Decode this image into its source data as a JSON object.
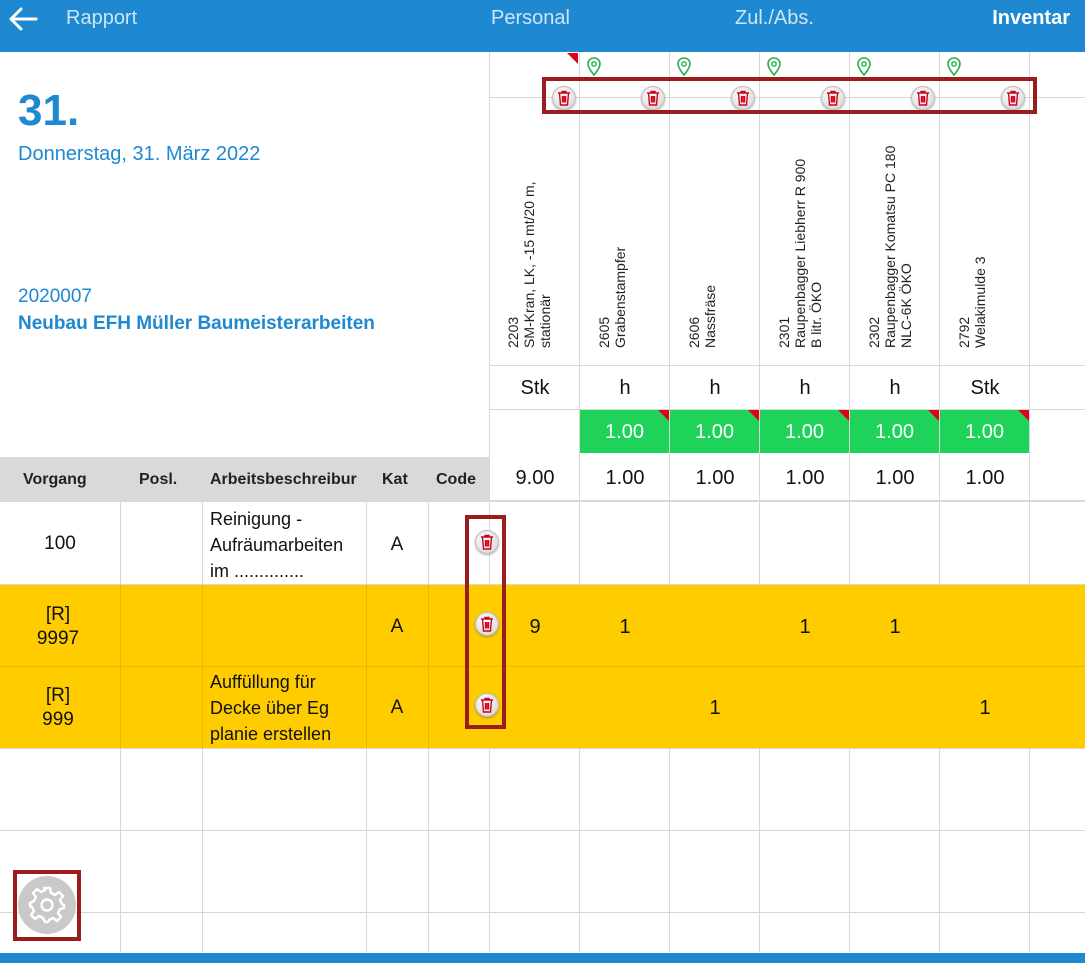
{
  "topbar": {
    "back_label": "Rapport",
    "tab_personal": "Personal",
    "tab_zul_abs": "Zul./Abs.",
    "tab_inventar": "Inventar",
    "color": "#1e88d0"
  },
  "header": {
    "day": "31.",
    "date_long": "Donnerstag, 31. März 2022",
    "project_number": "2020007",
    "project_name": "Neubau EFH Müller Baumeisterarbeiten"
  },
  "equipment": [
    {
      "number": "2203",
      "name_line1": "SM-Kran, LK, -15 mt/20 m,",
      "name_line2": "stationär",
      "unit": "Stk",
      "default_qty": "",
      "total": "9.00"
    },
    {
      "number": "2605",
      "name_line1": "Grabenstampfer",
      "name_line2": "",
      "unit": "h",
      "default_qty": "1.00",
      "total": "1.00"
    },
    {
      "number": "2606",
      "name_line1": "Nassfräse",
      "name_line2": "",
      "unit": "h",
      "default_qty": "1.00",
      "total": "1.00"
    },
    {
      "number": "2301",
      "name_line1": "Raupenbagger Liebherr R 900",
      "name_line2": "B litr. ÖKO",
      "unit": "h",
      "default_qty": "1.00",
      "total": "1.00"
    },
    {
      "number": "2302",
      "name_line1": "Raupenbagger Komatsu PC 180",
      "name_line2": "NLC-6K ÖKO",
      "unit": "h",
      "default_qty": "1.00",
      "total": "1.00"
    },
    {
      "number": "2792",
      "name_line1": "Welakimulde 3",
      "name_line2": "",
      "unit": "Stk",
      "default_qty": "1.00",
      "total": "1.00"
    }
  ],
  "columns": {
    "vorgang": "Vorgang",
    "posl": "Posl.",
    "arbeitsbeschreibung": "Arbeitsbeschreibur",
    "kat": "Kat",
    "code": "Code"
  },
  "rows": [
    {
      "vorgang_line1": "100",
      "vorgang_line2": "",
      "desc_line1": "Reinigung -",
      "desc_line2": "Aufräumarbeiten",
      "desc_line3": "im ..............",
      "kat": "A",
      "values": [
        "",
        "",
        "",
        "",
        "",
        ""
      ],
      "highlight": false
    },
    {
      "vorgang_line1": "[R]",
      "vorgang_line2": "9997",
      "desc_line1": "",
      "desc_line2": "",
      "desc_line3": "",
      "kat": "A",
      "values": [
        "9",
        "1",
        "",
        "1",
        "1",
        ""
      ],
      "highlight": true
    },
    {
      "vorgang_line1": "[R]",
      "vorgang_line2": "999",
      "desc_line1": "Auffüllung für",
      "desc_line2": "Decke über Eg",
      "desc_line3": "planie erstellen",
      "kat": "A",
      "values": [
        "",
        "",
        "1",
        "",
        "",
        "1"
      ],
      "highlight": true
    }
  ],
  "colors": {
    "accent": "#1e88d0",
    "highlight_row": "#ffcc00",
    "green_cell": "#1fd35a",
    "annotation_box": "#9b1c1c"
  }
}
